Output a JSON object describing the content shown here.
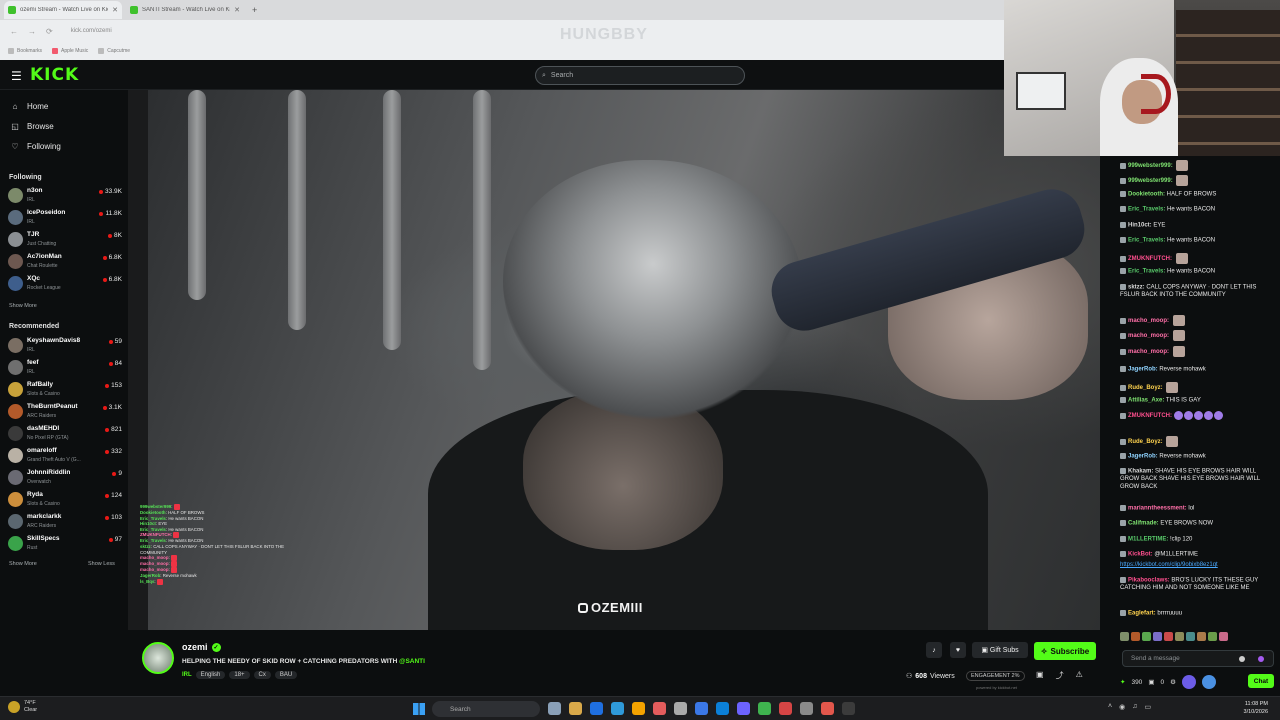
{
  "browser": {
    "tabs": [
      {
        "title": "ozemi Stream - Watch Live on Kick",
        "active": true
      },
      {
        "title": "SANTI Stream - Watch Live on Kick",
        "active": false
      }
    ],
    "url": "kick.com/ozemi",
    "overlay_text": "HUNGBBY",
    "bookmarks": [
      "Bookmarks",
      "Apple Music",
      "Capcutme"
    ]
  },
  "kick": {
    "logo": "KICK",
    "search_placeholder": "Search",
    "nav": [
      {
        "label": "Home",
        "icon": "home-icon"
      },
      {
        "label": "Browse",
        "icon": "compass-icon"
      },
      {
        "label": "Following",
        "icon": "heart-icon"
      }
    ],
    "following_heading": "Following",
    "following": [
      {
        "name": "n3on",
        "category": "IRL",
        "viewers": "33.9K",
        "color": "#7c8a6a"
      },
      {
        "name": "IcePoseidon",
        "category": "IRL",
        "viewers": "11.8K",
        "color": "#5a6b7d"
      },
      {
        "name": "TJR",
        "category": "Just Chatting",
        "viewers": "8K",
        "color": "#8b8f93"
      },
      {
        "name": "Ac7ionMan",
        "category": "Chat Roulette",
        "viewers": "6.8K",
        "color": "#6d5850"
      },
      {
        "name": "XQc",
        "category": "Rocket League",
        "viewers": "6.8K",
        "color": "#3e5e8c"
      }
    ],
    "show_more": "Show More",
    "recommended_heading": "Recommended",
    "recommended": [
      {
        "name": "KeyshawnDavis8",
        "category": "IRL",
        "viewers": "59",
        "color": "#7a6e63"
      },
      {
        "name": "feef",
        "category": "IRL",
        "viewers": "84",
        "color": "#6f6f6f"
      },
      {
        "name": "RafBally",
        "category": "Slots & Casino",
        "viewers": "153",
        "color": "#c8a23a"
      },
      {
        "name": "TheBurntPeanut",
        "category": "ARC Raiders",
        "viewers": "3.1K",
        "color": "#b35a2a"
      },
      {
        "name": "dasMEHDI",
        "category": "No Pixel RP (GTA)",
        "viewers": "821",
        "color": "#3a3a3a"
      },
      {
        "name": "omareloff",
        "category": "Grand Theft Auto V (G...",
        "viewers": "332",
        "color": "#b9b1a5"
      },
      {
        "name": "JohnniRiddlin",
        "category": "Overwatch",
        "viewers": "9",
        "color": "#6a6a73"
      },
      {
        "name": "Ryda",
        "category": "Slots & Casino",
        "viewers": "124",
        "color": "#cc8e3c"
      },
      {
        "name": "markclarkk",
        "category": "ARC Raiders",
        "viewers": "103",
        "color": "#5b6770"
      },
      {
        "name": "SkillSpecs",
        "category": "Rust",
        "viewers": "97",
        "color": "#3aa34a"
      }
    ],
    "show_less": "Show Less"
  },
  "video": {
    "watermark": "OZEMIII",
    "overlay_chat": [
      {
        "user": "999webster999",
        "text": "",
        "pink": false
      },
      {
        "user": "Dookietooth",
        "text": "HALF OF BROWS",
        "pink": false
      },
      {
        "user": "Eric_Travels",
        "text": "He wants BACON",
        "pink": false
      },
      {
        "user": "Hin10ct",
        "text": "EYE",
        "pink": false
      },
      {
        "user": "Eric_Travels",
        "text": "He wants BACON",
        "pink": false
      },
      {
        "user": "ZMUKNFUTCH",
        "text": "",
        "pink": true
      },
      {
        "user": "Eric_Travels",
        "text": "He wants BACON",
        "pink": false
      },
      {
        "user": "sktzz",
        "text": "CALL COPS ANYWAY · DONT LET THIS FSLUR BACK INTO THE COMMUNITY",
        "pink": false
      },
      {
        "user": "macho_moop",
        "text": "",
        "pink": true
      },
      {
        "user": "macho_moop",
        "text": "",
        "pink": true
      },
      {
        "user": "macho_moop",
        "text": "",
        "pink": true
      },
      {
        "user": "JagerRob",
        "text": "Reverse mohawk",
        "pink": false
      },
      {
        "user": "ls_Bqs",
        "text": "",
        "pink": false
      }
    ]
  },
  "chat": {
    "messages": [
      {
        "user": "999webster999:",
        "text": "",
        "color": "#7ee070",
        "emote": true
      },
      {
        "user": "999webster999:",
        "text": "",
        "color": "#7ee070",
        "emote": true
      },
      {
        "user": "Dookietooth:",
        "text": "HALF OF BROWS",
        "color": "#7ee070"
      },
      {
        "user": "Eric_Travels:",
        "text": "He wants BACON",
        "color": "#58c96a"
      },
      {
        "user": "Hin10ct:",
        "text": "EYE",
        "color": "#d9d9d9"
      },
      {
        "user": "Eric_Travels:",
        "text": "He wants BACON",
        "color": "#58c96a"
      },
      {
        "user": "ZMUKNFUTCH:",
        "text": "",
        "color": "#ff4f8e",
        "emote": true
      },
      {
        "user": "Eric_Travels:",
        "text": "He wants BACON",
        "color": "#58c96a"
      },
      {
        "user": "sktzz:",
        "text": "CALL COPS ANYWAY · DONT LET THIS FSLUR BACK INTO THE COMMUNITY",
        "color": "#d9d9d9"
      },
      {
        "user": "macho_moop:",
        "text": "",
        "color": "#ff6fa8",
        "emote": true
      },
      {
        "user": "macho_moop:",
        "text": "",
        "color": "#ff6fa8",
        "emote": true
      },
      {
        "user": "macho_moop:",
        "text": "",
        "color": "#ff6fa8",
        "emote": true
      },
      {
        "user": "JagerRob:",
        "text": "Reverse mohawk",
        "color": "#8fd3ff"
      },
      {
        "user": "Rude_Boyz:",
        "text": "",
        "color": "#ffd34f",
        "emote": true
      },
      {
        "user": "Attilias_Axe:",
        "text": "THIS IS GAY",
        "color": "#7ee070"
      },
      {
        "user": "ZMUKNFUTCH:",
        "text": "",
        "color": "#ff4f8e",
        "emoterow": true
      },
      {
        "user": "Rude_Boyz:",
        "text": "",
        "color": "#ffd34f",
        "emote": true
      },
      {
        "user": "JagerRob:",
        "text": "Reverse mohawk",
        "color": "#8fd3ff"
      },
      {
        "user": "Khakam:",
        "text": "SHAVE HIS EYE BROWS HAIR WILL GROW BACK SHAVE HIS EYE BROWS HAIR WILL GROW BACK",
        "color": "#d9d9d9"
      },
      {
        "user": "marianntheessment:",
        "text": "lol",
        "color": "#ff6fa8"
      },
      {
        "user": "Califmade:",
        "text": "EYE BROWS NOW",
        "color": "#7ee070"
      },
      {
        "user": "M1LLERTIME:",
        "text": "!clip 120",
        "color": "#58c96a"
      },
      {
        "user": "KickBot:",
        "text": "@M1LLERTIME",
        "color": "#ff4f8e"
      },
      {
        "user": "",
        "text": "https://kickbot.com/clip/9obixb8ez1qt",
        "color": "#4aa9ff",
        "link": true
      },
      {
        "user": "Pikabooclaws:",
        "text": "BRO'S LUCKY ITS THESE GUY CATCHING HIM AND NOT SOMEONE LIKE ME",
        "color": "#ff4f8e"
      },
      {
        "user": "Eaglefart:",
        "text": "brrrruuuu",
        "color": "#ffd34f"
      }
    ],
    "input_placeholder": "Send a message",
    "points": "390",
    "count": "0",
    "chat_button": "Chat"
  },
  "stream": {
    "name": "ozemi",
    "title_prefix": "HELPING THE NEEDY OF SKID ROW + CATCHING PREDATORS WITH",
    "title_mention": "@SANTI",
    "category": "IRL",
    "tags": [
      "English",
      "18+",
      "Cx",
      "BAU"
    ],
    "gift_subs": "Gift Subs",
    "subscribe": "Subscribe",
    "viewers": "608",
    "viewers_label": "Viewers",
    "engagement": "ENGAGEMENT 2%",
    "powered_by": "powered by kickbot.net"
  },
  "taskbar": {
    "temperature": "74°F",
    "condition": "Clear",
    "search_placeholder": "Search",
    "time": "11:08 PM",
    "date": "3/10/2026",
    "app_colors": [
      "#8aa0b8",
      "#d9a94a",
      "#1f6fe0",
      "#2f9ad9",
      "#f4a300",
      "#e55d5d",
      "#aaa",
      "#3b78e7",
      "#0b80d8",
      "#6c63ff",
      "#3fb34f",
      "#d64545",
      "#8a8a8a",
      "#e2574c",
      "#3b3b3b"
    ]
  }
}
